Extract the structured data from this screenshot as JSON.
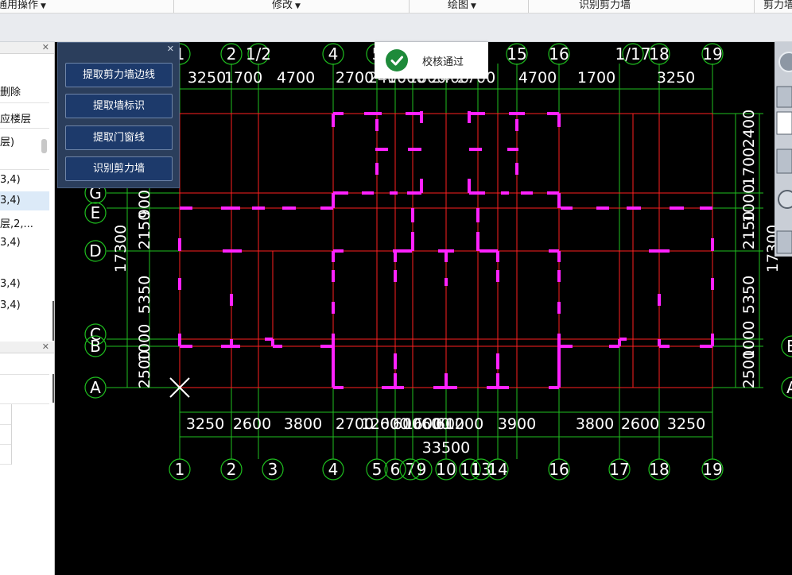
{
  "ribbon": {
    "tabs": [
      "通用操作",
      "修改",
      "绘图",
      "识别剪力墙",
      "剪力墙"
    ]
  },
  "left_panel": {
    "rows": [
      "删除",
      "应楼层",
      "层)",
      "3,4)",
      "3,4)",
      "层,2,...",
      "3,4)",
      "3,4)",
      "3,4)"
    ]
  },
  "float_panel": {
    "buttons": [
      "提取剪力墙边线",
      "提取墙标识",
      "提取门窗线",
      "识别剪力墙"
    ]
  },
  "toast": {
    "message": "校核通过",
    "color": "#1e8a3a"
  },
  "cad": {
    "colors": {
      "grid": "#ff2020",
      "dim": "#1fbf1f",
      "wall": "#ff22ff",
      "text": "#ffffff"
    },
    "top_axis_labels": [
      "1",
      "2",
      "1/2",
      "4",
      "5",
      "15",
      "16",
      "1/17",
      "18",
      "19"
    ],
    "bottom_axis_labels": [
      "1",
      "2",
      "3",
      "4",
      "5",
      "6",
      "7",
      "9",
      "10",
      "11",
      "13",
      "14",
      "16",
      "17",
      "18",
      "19"
    ],
    "left_axis_labels": [
      "G",
      "E",
      "D",
      "C",
      "B",
      "A"
    ],
    "right_axis_labels": [
      "D",
      "B",
      "A"
    ],
    "top_dim_row": [
      "3250",
      "1700",
      "4700",
      "2700",
      "2400",
      "1600",
      "1600",
      "2400",
      "2700",
      "4700",
      "1700",
      "3250"
    ],
    "bottom_dim_row": [
      "3250",
      "2600",
      "3800",
      "2700",
      "1200",
      "600",
      "600",
      "1600",
      "600",
      "600",
      "1200",
      "3900",
      "3800",
      "2600",
      "3250"
    ],
    "bottom_total": "33500",
    "left_dims": [
      "17300",
      "2150",
      "5350",
      "2500",
      "1000",
      "900"
    ],
    "right_dims": [
      "2400",
      "1700",
      "1000",
      "2150",
      "5350",
      "1000",
      "2500",
      "17300"
    ]
  }
}
